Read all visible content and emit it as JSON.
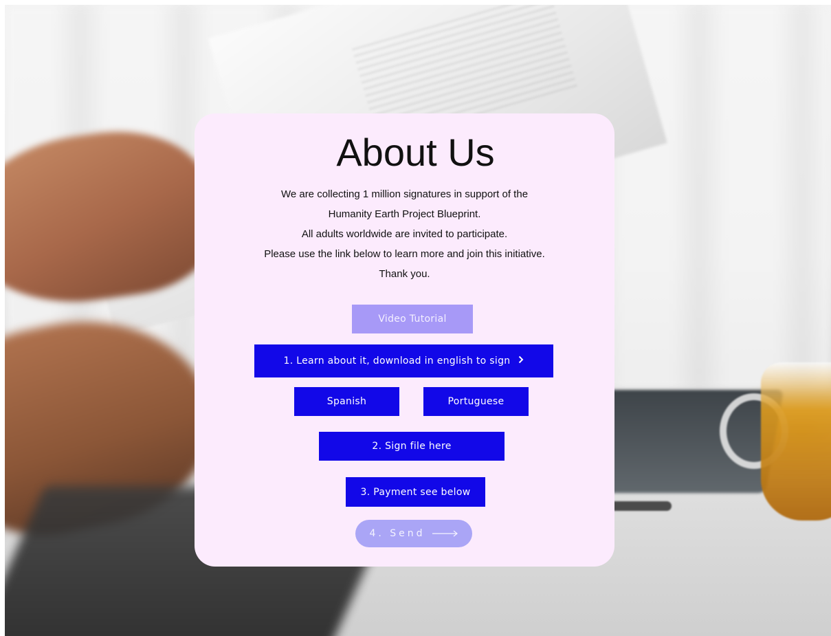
{
  "title": "About Us",
  "intro_lines": [
    "We are collecting 1 million signatures in support of the",
    "Humanity Earth Project Blueprint.",
    "All adults worldwide are invited to participate.",
    "Please use the link below to learn more and join this initiative.",
    "Thank you."
  ],
  "buttons": {
    "video_tutorial": "Video Tutorial",
    "learn_download": "1. Learn about it, download in english to sign",
    "spanish": "Spanish",
    "portuguese": "Portuguese",
    "sign_file": "2. Sign file here",
    "payment": "3. Payment see below",
    "send": "4. Send"
  },
  "icons": {
    "learn_chevron": "chevron-right-icon",
    "send_arrow": "long-arrow-right-icon"
  },
  "colors": {
    "card_bg": "#fcebfd",
    "primary_button": "#1208e8",
    "video_button": "#a799f7",
    "send_button": "#aaa5f6",
    "text": "#111111"
  }
}
